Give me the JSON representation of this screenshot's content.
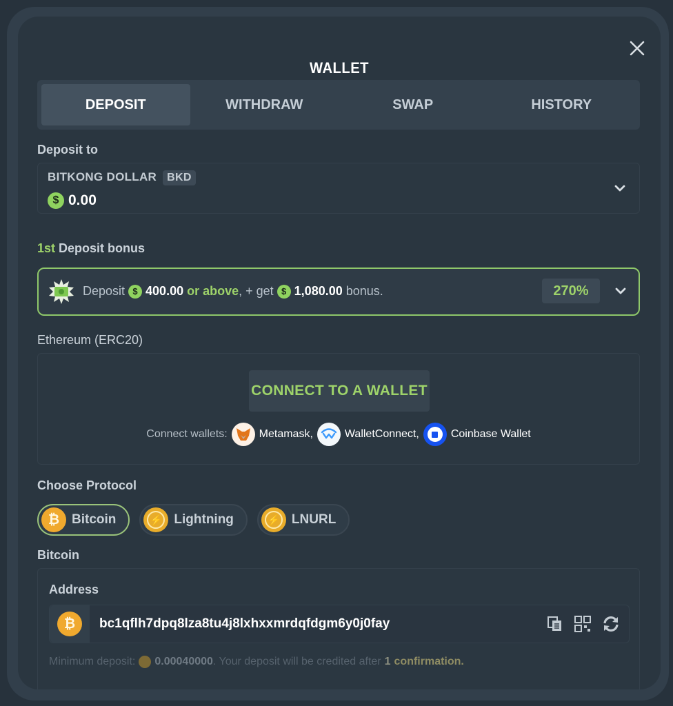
{
  "modal": {
    "title": "WALLET",
    "close_icon": "close-icon"
  },
  "tabs": [
    {
      "label": "DEPOSIT",
      "active": true
    },
    {
      "label": "WITHDRAW",
      "active": false
    },
    {
      "label": "SWAP",
      "active": false
    },
    {
      "label": "HISTORY",
      "active": false
    }
  ],
  "deposit_to": {
    "label": "Deposit to",
    "currency_name": "BITKONG DOLLAR",
    "currency_code": "BKD",
    "balance": "0.00",
    "icon": "dollar-coin-icon"
  },
  "bonus": {
    "label_highlight": "1st",
    "label_rest": " Deposit bonus",
    "text_prefix": "Deposit",
    "min_amount": "400.00",
    "or_above": "or above",
    "mid_text": ", + get",
    "bonus_amount": "1,080.00",
    "suffix": "bonus.",
    "percent": "270%"
  },
  "ethereum": {
    "label": "Ethereum (ERC20)",
    "connect_button": "CONNECT TO A WALLET",
    "connect_wallets_label": "Connect wallets:",
    "wallets": [
      {
        "name": "Metamask,",
        "icon": "metamask-icon"
      },
      {
        "name": "WalletConnect,",
        "icon": "walletconnect-icon"
      },
      {
        "name": "Coinbase Wallet",
        "icon": "coinbase-icon"
      }
    ]
  },
  "protocol": {
    "label": "Choose Protocol",
    "options": [
      {
        "label": "Bitcoin",
        "icon": "bitcoin-icon",
        "active": true
      },
      {
        "label": "Lightning",
        "icon": "lightning-icon",
        "active": false
      },
      {
        "label": "LNURL",
        "icon": "lightning-icon",
        "active": false
      }
    ]
  },
  "bitcoin": {
    "section_label": "Bitcoin",
    "address_label": "Address",
    "address": "bc1qflh7dpq8lza8tu4j8lxhxxmrdqfdgm6y0j0fay",
    "min_deposit_label": "Minimum deposit:",
    "min_deposit_value": "0.00040000",
    "credit_text": ". Your deposit will be credited after",
    "confirmations": "1",
    "confirmation_word": "confirmation."
  },
  "colors": {
    "accent_green": "#9ed36a",
    "bitcoin_orange": "#f0a92e",
    "background": "#2a3640"
  }
}
